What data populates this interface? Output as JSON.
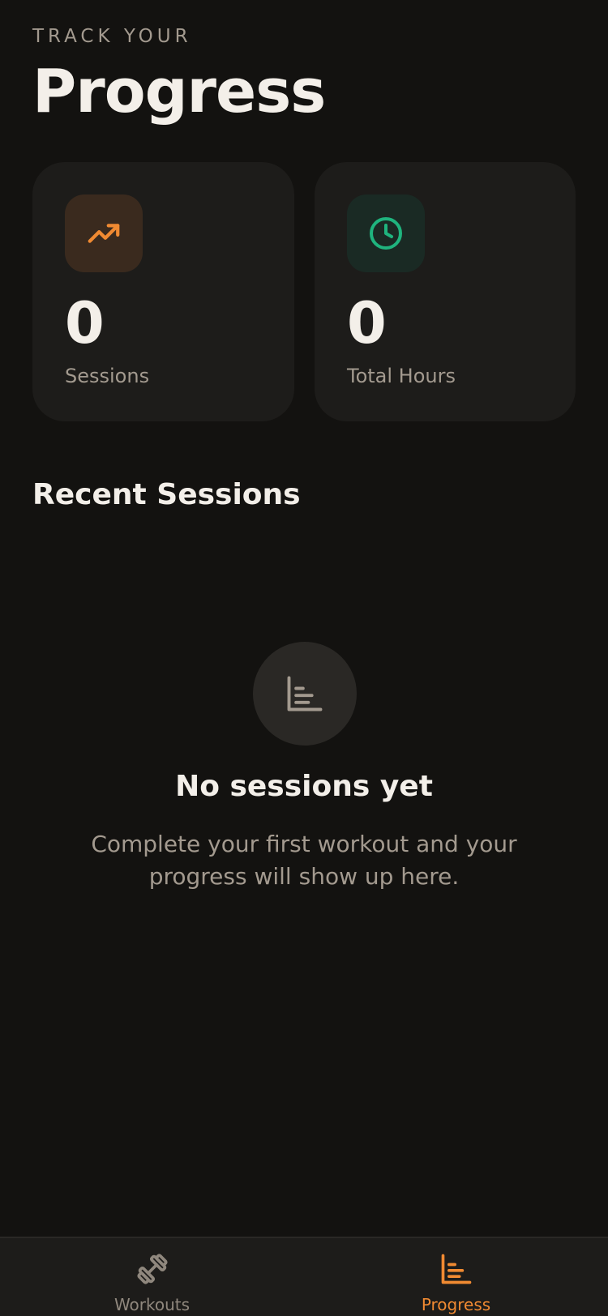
{
  "header": {
    "eyebrow": "TRACK YOUR",
    "title": "Progress"
  },
  "stats": [
    {
      "icon": "trending-up-icon",
      "value": "0",
      "label": "Sessions",
      "accent": "#f08a32"
    },
    {
      "icon": "clock-icon",
      "value": "0",
      "label": "Total Hours",
      "accent": "#1fb47e"
    }
  ],
  "recent": {
    "title": "Recent Sessions",
    "empty_icon": "bar-chart-icon",
    "empty_title": "No sessions yet",
    "empty_text": "Complete your first workout and your progress will show up here."
  },
  "tabbar": {
    "tabs": [
      {
        "label": "Workouts",
        "icon": "dumbbell-icon",
        "active": false
      },
      {
        "label": "Progress",
        "icon": "bar-chart-icon",
        "active": true
      }
    ]
  },
  "colors": {
    "background": "#131210",
    "card": "#1d1c1a",
    "accent": "#f08a32",
    "green": "#1fb47e",
    "muted": "#a39a8f"
  }
}
